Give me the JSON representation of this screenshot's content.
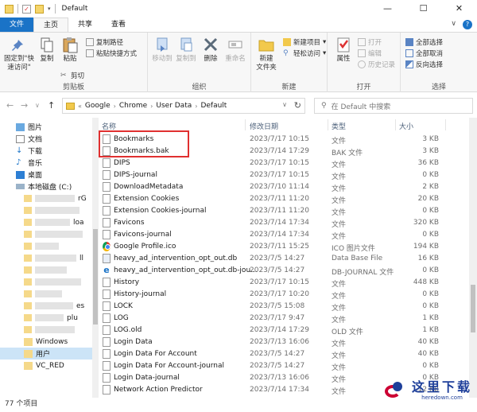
{
  "window": {
    "title": "Default",
    "minimize": "—",
    "maximize": "☐",
    "close": "✕"
  },
  "tabs": {
    "file": "文件",
    "home": "主页",
    "share": "共享",
    "view": "查看",
    "expand": "∨",
    "help": "?"
  },
  "ribbon": {
    "clipboard": {
      "label": "剪贴板",
      "pin": "固定到\"快\n速访问\"",
      "copy": "复制",
      "paste": "粘贴",
      "cut": "剪切",
      "copy_path": "复制路径",
      "paste_shortcut": "粘贴快捷方式"
    },
    "organize": {
      "label": "组织",
      "move_to": "移动到",
      "copy_to": "复制到",
      "delete": "删除",
      "rename": "重命名"
    },
    "new": {
      "label": "新建",
      "new_folder": "新建\n文件夹",
      "new_item": "新建项目",
      "easy_access": "轻松访问"
    },
    "open": {
      "label": "打开",
      "properties": "属性",
      "open": "打开",
      "edit": "编辑",
      "history": "历史记录"
    },
    "select": {
      "label": "选择",
      "select_all": "全部选择",
      "select_none": "全部取消",
      "invert": "反向选择"
    }
  },
  "address": {
    "back": "←",
    "forward": "→",
    "dropdown": "∨",
    "up": "↑",
    "overflow": "«",
    "crumbs": [
      "Google",
      "Chrome",
      "User Data",
      "Default"
    ],
    "search_placeholder": "在 Default 中搜索"
  },
  "nav": {
    "items": [
      {
        "label": "图片",
        "icon": "pictures-icon"
      },
      {
        "label": "文档",
        "icon": "documents-icon"
      },
      {
        "label": "下载",
        "icon": "downloads-icon"
      },
      {
        "label": "音乐",
        "icon": "music-icon"
      },
      {
        "label": "桌面",
        "icon": "desktop-icon"
      },
      {
        "label": "本地磁盘 (C:)",
        "icon": "drive-icon"
      }
    ],
    "partials": [
      "rG",
      "loa",
      "ll",
      "es",
      "plu"
    ],
    "windows_label": "Windows",
    "user_label": "用户",
    "vc_label": "VC_RED"
  },
  "columns": {
    "name": "名称",
    "modified": "修改日期",
    "type": "类型",
    "size": "大小"
  },
  "files": [
    {
      "name": "Bookmarks",
      "date": "2023/7/17 10:15",
      "type": "文件",
      "size": "3 KB",
      "icon": "file-icon"
    },
    {
      "name": "Bookmarks.bak",
      "date": "2023/7/14 17:29",
      "type": "BAK 文件",
      "size": "3 KB",
      "icon": "file-icon"
    },
    {
      "name": "DIPS",
      "date": "2023/7/17 10:15",
      "type": "文件",
      "size": "36 KB",
      "icon": "file-icon"
    },
    {
      "name": "DIPS-journal",
      "date": "2023/7/17 10:15",
      "type": "文件",
      "size": "0 KB",
      "icon": "file-icon"
    },
    {
      "name": "DownloadMetadata",
      "date": "2023/7/10 11:14",
      "type": "文件",
      "size": "2 KB",
      "icon": "file-icon"
    },
    {
      "name": "Extension Cookies",
      "date": "2023/7/11 11:20",
      "type": "文件",
      "size": "20 KB",
      "icon": "file-icon"
    },
    {
      "name": "Extension Cookies-journal",
      "date": "2023/7/11 11:20",
      "type": "文件",
      "size": "0 KB",
      "icon": "file-icon"
    },
    {
      "name": "Favicons",
      "date": "2023/7/14 17:34",
      "type": "文件",
      "size": "320 KB",
      "icon": "file-icon"
    },
    {
      "name": "Favicons-journal",
      "date": "2023/7/14 17:34",
      "type": "文件",
      "size": "0 KB",
      "icon": "file-icon"
    },
    {
      "name": "Google Profile.ico",
      "date": "2023/7/11 15:25",
      "type": "ICO 图片文件",
      "size": "194 KB",
      "icon": "chrome-icon"
    },
    {
      "name": "heavy_ad_intervention_opt_out.db",
      "date": "2023/7/5 14:27",
      "type": "Data Base File",
      "size": "16 KB",
      "icon": "database-icon"
    },
    {
      "name": "heavy_ad_intervention_opt_out.db-jou...",
      "date": "2023/7/5 14:27",
      "type": "DB-JOURNAL 文件",
      "size": "0 KB",
      "icon": "ie-icon"
    },
    {
      "name": "History",
      "date": "2023/7/17 10:15",
      "type": "文件",
      "size": "448 KB",
      "icon": "file-icon"
    },
    {
      "name": "History-journal",
      "date": "2023/7/17 10:20",
      "type": "文件",
      "size": "0 KB",
      "icon": "file-icon"
    },
    {
      "name": "LOCK",
      "date": "2023/7/5 15:08",
      "type": "文件",
      "size": "0 KB",
      "icon": "file-icon"
    },
    {
      "name": "LOG",
      "date": "2023/7/17 9:47",
      "type": "文件",
      "size": "1 KB",
      "icon": "file-icon"
    },
    {
      "name": "LOG.old",
      "date": "2023/7/14 17:29",
      "type": "OLD 文件",
      "size": "1 KB",
      "icon": "file-icon"
    },
    {
      "name": "Login Data",
      "date": "2023/7/13 16:06",
      "type": "文件",
      "size": "40 KB",
      "icon": "file-icon"
    },
    {
      "name": "Login Data For Account",
      "date": "2023/7/5 14:27",
      "type": "文件",
      "size": "40 KB",
      "icon": "file-icon"
    },
    {
      "name": "Login Data For Account-journal",
      "date": "2023/7/5 14:27",
      "type": "文件",
      "size": "0 KB",
      "icon": "file-icon"
    },
    {
      "name": "Login Data-journal",
      "date": "2023/7/13 16:06",
      "type": "文件",
      "size": "0 KB",
      "icon": "file-icon"
    },
    {
      "name": "Network Action Predictor",
      "date": "2023/7/14 17:34",
      "type": "文件",
      "size": "12 KB",
      "icon": "file-icon"
    }
  ],
  "status": {
    "count": "77 个项目"
  },
  "watermark": {
    "text": "这里下载",
    "url": "heredown.com"
  }
}
